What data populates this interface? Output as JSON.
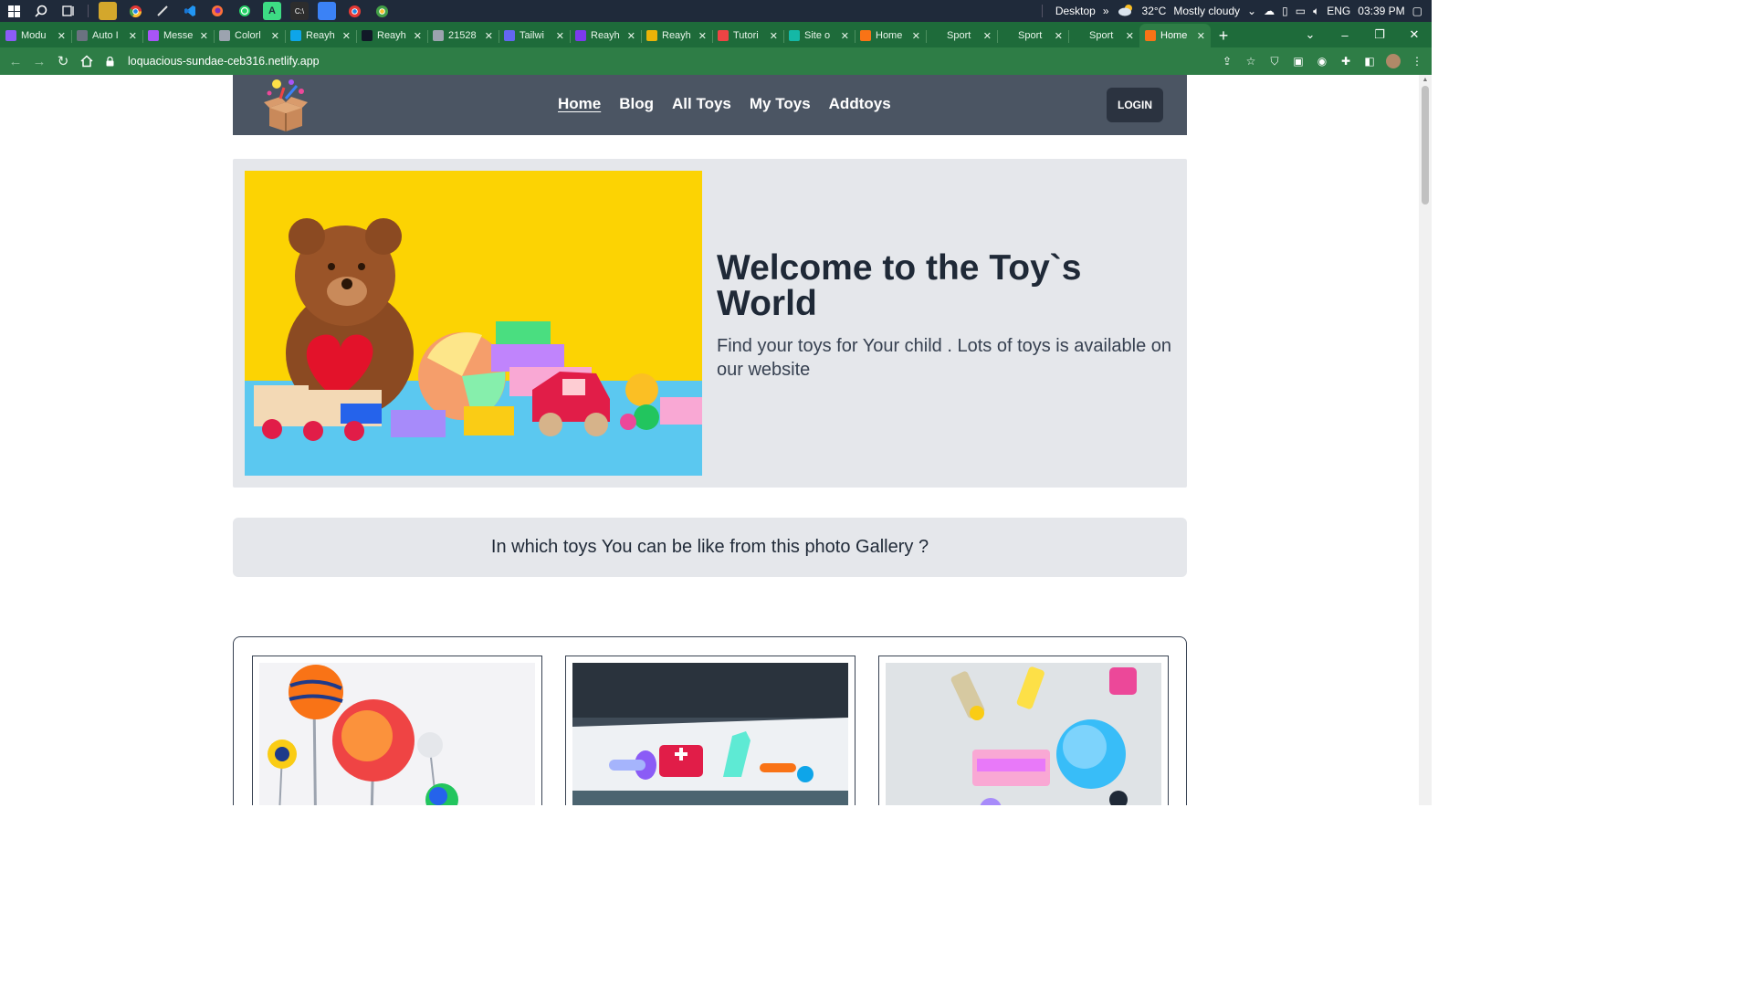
{
  "taskbar": {
    "desktop_label": "Desktop",
    "weather_temp": "32°C",
    "weather_desc": "Mostly cloudy",
    "lang": "ENG",
    "time": "03:39 PM"
  },
  "browser": {
    "tabs": [
      {
        "label": "Modu",
        "color": "#8b5cf6"
      },
      {
        "label": "Auto I",
        "color": "#6b7280"
      },
      {
        "label": "Messe",
        "color": "#a855f7"
      },
      {
        "label": "Colorl",
        "color": "#9ca3af"
      },
      {
        "label": "Reayh",
        "color": "#0ea5e9"
      },
      {
        "label": "Reayh",
        "color": "#111827"
      },
      {
        "label": "21528",
        "color": "#9ca3af"
      },
      {
        "label": "Tailwi",
        "color": "#6366f1"
      },
      {
        "label": "Reayh",
        "color": "#7c3aed"
      },
      {
        "label": "Reayh",
        "color": "#eab308"
      },
      {
        "label": "Tutori",
        "color": "#ef4444"
      },
      {
        "label": "Site o",
        "color": "#14b8a6"
      },
      {
        "label": "Home",
        "color": "#f97316"
      },
      {
        "label": "Sport",
        "color": "#1e6b3a"
      },
      {
        "label": "Sport",
        "color": "#1e6b3a"
      },
      {
        "label": "Sport",
        "color": "#1e6b3a"
      },
      {
        "label": "Home",
        "color": "#f97316",
        "active": true
      }
    ],
    "url": "loquacious-sundae-ceb316.netlify.app"
  },
  "site": {
    "nav_links": [
      "Home",
      "Blog",
      "All Toys",
      "My Toys",
      "Addtoys"
    ],
    "login_label": "LOGIN",
    "hero_title": "Welcome to the Toy`s World",
    "hero_subtitle": "Find your toys for Your child . Lots of toys is available on our website",
    "gallery_heading": "In which toys You can be like from this photo Gallery ?"
  },
  "colors": {
    "navbar": "#4b5563",
    "login_button": "#2b3340",
    "panel": "#e5e7eb",
    "chrome_frame": "#1e6b3a"
  }
}
